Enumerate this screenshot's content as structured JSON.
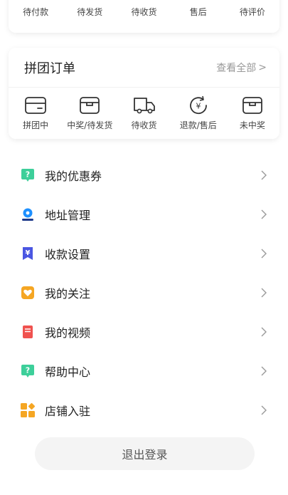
{
  "top_orders": {
    "items": [
      {
        "label": "待付款",
        "icon": "wallet-icon"
      },
      {
        "label": "待发货",
        "icon": "box-icon"
      },
      {
        "label": "待收货",
        "icon": "truck-icon"
      },
      {
        "label": "售后",
        "icon": "refund-icon"
      },
      {
        "label": "待评价",
        "icon": "comment-icon"
      }
    ]
  },
  "group_orders": {
    "title": "拼团订单",
    "view_all": "查看全部",
    "items": [
      {
        "label": "拼团中",
        "icon": "wallet-icon"
      },
      {
        "label": "中奖/待发货",
        "icon": "box-icon"
      },
      {
        "label": "待收货",
        "icon": "truck-icon"
      },
      {
        "label": "退款/售后",
        "icon": "refund-icon"
      },
      {
        "label": "未中奖",
        "icon": "box-icon"
      }
    ]
  },
  "menu": {
    "items": [
      {
        "label": "我的优惠券",
        "icon": "coupon-icon",
        "color": "#3dcf9a"
      },
      {
        "label": "地址管理",
        "icon": "location-pin-icon",
        "color": "#1e90ff"
      },
      {
        "label": "收款设置",
        "icon": "yuan-bookmark-icon",
        "color": "#4a56e2"
      },
      {
        "label": "我的关注",
        "icon": "heart-icon",
        "color": "#f5a623"
      },
      {
        "label": "我的视频",
        "icon": "video-book-icon",
        "color": "#f0524f"
      },
      {
        "label": "帮助中心",
        "icon": "help-icon",
        "color": "#3dcf9a"
      },
      {
        "label": "店铺入驻",
        "icon": "shop-grid-icon",
        "color": "#f5a623"
      }
    ]
  },
  "logout_label": "退出登录"
}
